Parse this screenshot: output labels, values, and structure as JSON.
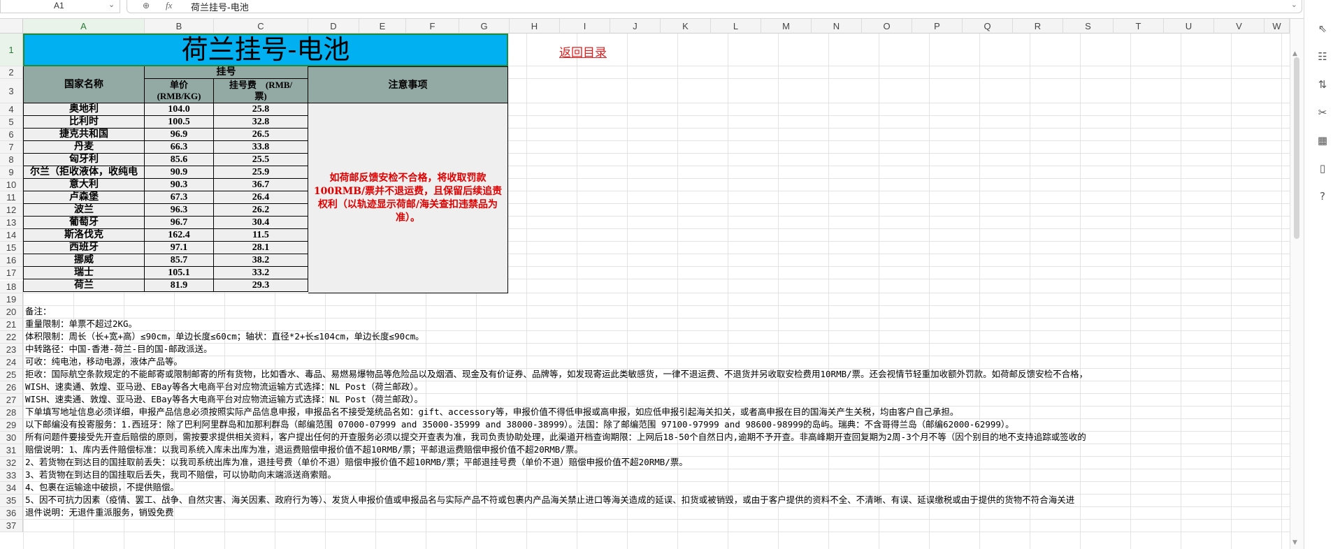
{
  "formula_bar": {
    "name_box": "A1",
    "zoom_icon": "zoom-icon",
    "fx_label": "fx",
    "content": "荷兰挂号-电池"
  },
  "column_headers": [
    "A",
    "B",
    "C",
    "D",
    "E",
    "F",
    "G",
    "H",
    "I",
    "J",
    "K",
    "L",
    "M",
    "N",
    "O",
    "P",
    "Q",
    "R",
    "S",
    "T",
    "U",
    "V",
    "W"
  ],
  "row_headers": [
    "1",
    "2",
    "3",
    "4",
    "5",
    "6",
    "7",
    "8",
    "9",
    "10",
    "11",
    "12",
    "13",
    "14",
    "15",
    "16",
    "17",
    "18",
    "19",
    "20",
    "21",
    "22",
    "23",
    "24",
    "25",
    "26",
    "27",
    "28",
    "29",
    "30",
    "31",
    "32",
    "33",
    "34",
    "35",
    "36",
    "37"
  ],
  "sheet": {
    "title": "荷兰挂号-电池",
    "back_link": "返回目录",
    "header": {
      "country": "国家名称",
      "group": "挂号",
      "unit_price": "单价\n(RMB/KG)",
      "reg_fee": "挂号费    (RMB/\n票)",
      "notes": "注意事项"
    },
    "notes_text": "如荷邮反馈安检不合格，将收取罚款100RMB/票并不退运费，且保留后续追责权利（以轨迹显示荷邮/海关查扣违禁品为准）。",
    "rows": [
      {
        "country": "奥地利",
        "price": "104.0",
        "fee": "25.8"
      },
      {
        "country": "比利时",
        "price": "100.5",
        "fee": "32.8"
      },
      {
        "country": "捷克共和国",
        "price": "96.9",
        "fee": "26.5"
      },
      {
        "country": "丹麦",
        "price": "66.3",
        "fee": "33.8"
      },
      {
        "country": "匈牙利",
        "price": "85.6",
        "fee": "25.5"
      },
      {
        "country": "尔兰（拒收液体，收纯电",
        "price": "90.9",
        "fee": "25.9"
      },
      {
        "country": "意大利",
        "price": "90.3",
        "fee": "36.7"
      },
      {
        "country": "卢森堡",
        "price": "67.3",
        "fee": "26.4"
      },
      {
        "country": "波兰",
        "price": "96.3",
        "fee": "26.2"
      },
      {
        "country": "葡萄牙",
        "price": "96.7",
        "fee": "30.4"
      },
      {
        "country": "斯洛伐克",
        "price": "162.4",
        "fee": "11.5"
      },
      {
        "country": "西班牙",
        "price": "97.1",
        "fee": "28.1"
      },
      {
        "country": "挪威",
        "price": "85.7",
        "fee": "38.2"
      },
      {
        "country": "瑞士",
        "price": "105.1",
        "fee": "33.2"
      },
      {
        "country": "荷兰",
        "price": "81.9",
        "fee": "29.3"
      }
    ],
    "remarks": [
      "备注：",
      "重量限制：单票不超过2KG。",
      "体积限制：周长（长+宽+高）≤90cm，单边长度≤60cm；轴状：直径*2+长≤104cm，单边长度≤90cm。",
      "中转路径：中国-香港-荷兰-目的国-邮政派送。",
      "可收：纯电池，移动电源，液体产品等。",
      "拒收：国际航空条款规定的不能邮寄或限制邮寄的所有货物，比如香水、毒品、易燃易爆物品等危险品以及烟酒、现金及有价证券、品牌等，如发现寄运此类敏感货，一律不退运费、不退货并另收取安检费用10RMB/票。还会视情节轻重加收额外罚款。如荷邮反馈安检不合格，",
      "WISH、速卖通、敦煌、亚马逊、EBay等各大电商平台对应物流运输方式选择：NL Post（荷兰邮政）。",
      "WISH、速卖通、敦煌、亚马逊、EBay等各大电商平台对应物流运输方式选择：NL Post（荷兰邮政）。",
      "下单填写地址信息必须详细，申报产品信息必须按照实际产品信息申报，申报品名不接受笼统品名如：gift、accessory等，申报价值不得低申报或高申报，如应低申报引起海关扣关，或者高申报在目的国海关产生关税，均由客户自己承担。",
      "以下邮编没有投寄服务：1.西班牙：除了巴利阿里群岛和加那利群岛（邮编范围 07000-07999 and 35000-35999 and 38000-38999）。法国：除了邮编范围 97100-97999 and 98600-98999的岛屿。瑞典：不含哥得兰岛（邮编62000-62999）。",
      "所有问题件要接受先开查后赔偿的原则，需按要求提供相关资料，客户提出任何的开查服务必须以提交开查表为准，我司负责协助处理，此渠道开档查询期限：上网后18-50个自然日内,逾期不予开查。非高峰期开查回复期为2周-3个月不等（因个别目的地不支持追踪或签收的",
      "赔偿说明：1、库内丢件赔偿标准：以我司系统入库未出库为准，退运费赔偿申报价值不超10RMB/票；平邮退运费赔偿申报价值不超20RMB/票。",
      "2、若货物在到达目的国挂取前丢失：以我司系统出库为准，退挂号费（单价不退）赔偿申报价值不超10RMB/票；平邮退挂号费（单价不退）赔偿申报价值不超20RMB/票。",
      "3、若货物在到达目的国挂取后丢失，我司不赔偿，可以协助向末端派送商索赔。",
      "4、包裹在运输途中破损，不提供赔偿。",
      "5、因不可抗力因素（疫情、罢工、战争、自然灾害、海关因素、政府行为等）、发货人申报价值或申报品名与实际产品不符或包裹内产品海关禁止进口等海关造成的延误、扣货或被销毁，或由于客户提供的资料不全、不清晰、有误、延误缴税或由于提供的货物不符合海关进",
      "退件说明：无退件重派服务，销毁免费"
    ]
  },
  "right_sidebar_icons": [
    "select-icon",
    "filter-settings-icon",
    "sort-icon",
    "tools-icon",
    "chart-icon",
    "book-icon",
    "help-icon"
  ],
  "colors": {
    "title_bg": "#00b0f0",
    "header_bg": "#93aaa4",
    "body_bg": "#efefef",
    "alert": "#e00000",
    "link": "#e02020"
  }
}
